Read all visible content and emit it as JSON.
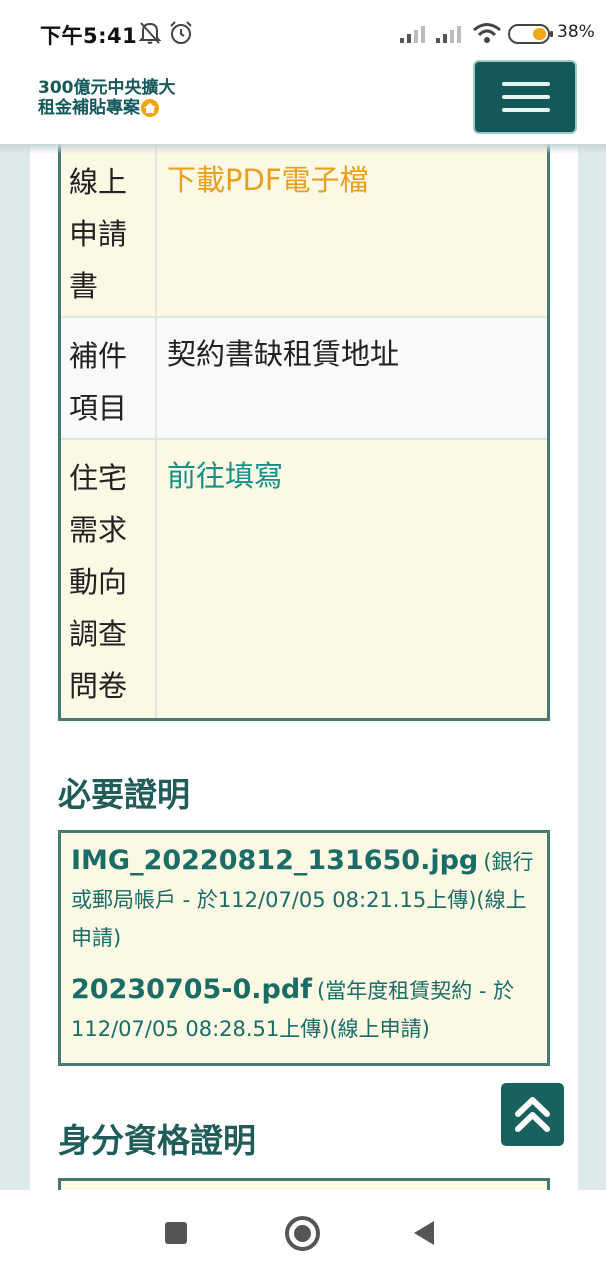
{
  "status_bar": {
    "time": "下午5:41",
    "battery": "38%"
  },
  "header": {
    "logo_line1": "300億元中央擴大",
    "logo_line2": "租金補貼專案"
  },
  "table": {
    "rows": [
      {
        "label": "線上申請書",
        "label_lines": [
          "線上",
          "申請",
          "書"
        ],
        "value": "下載PDF電子檔"
      },
      {
        "label": "補件項目",
        "label_lines": [
          "補件",
          "項目"
        ],
        "value": "契約書缺租賃地址"
      },
      {
        "label": "住宅需求動向調查問卷",
        "label_lines": [
          "住宅",
          "需求",
          "動向",
          "調查",
          "問卷"
        ],
        "value": "前往填寫"
      }
    ]
  },
  "required_docs": {
    "title": "必要證明",
    "files": [
      {
        "name": "IMG_20220812_131650.jpg",
        "meta": "(銀行或郵局帳戶 - 於112/07/05 08:21.15上傳)(線上申請)"
      },
      {
        "name": "20230705-0.pdf",
        "meta": "(當年度租賃契約 - 於112/07/05 08:28.51上傳)(線上申請)"
      }
    ]
  },
  "identity_docs": {
    "title": "身分資格證明"
  },
  "colors": {
    "brand_teal": "#13595a",
    "link_orange": "#e8a01e",
    "link_teal": "#17908a",
    "cream": "#fbf8e4"
  }
}
